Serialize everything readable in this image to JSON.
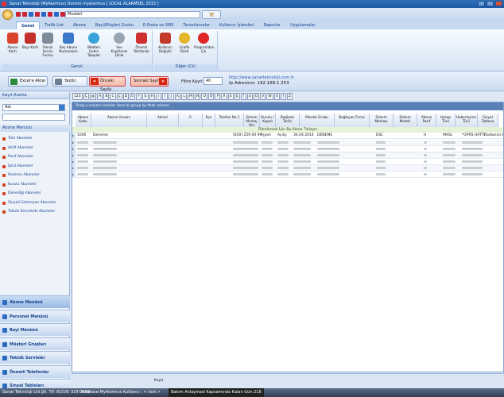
{
  "title": "Sanat Teknoloji (MyAlarmus) Donem myalarmus [ LOCAL ALARMSEL 2013 ]",
  "quick_combo": "Musteri",
  "tabs": [
    "Genel",
    "Trafik List",
    "Abone",
    "Bayi/Müşteri Grubu",
    "E-Posta ve SMS",
    "Tanımlamalar",
    "Kullanıcı İşlemleri",
    "Raporlar",
    "Uygulamalar"
  ],
  "ribbon": {
    "group_genel": "Genel",
    "group_diger": "Diğer (Ck)",
    "buttons": [
      "Abone Kartı",
      "Bayi Kartı",
      "Teknik Servis Formu",
      "Boş Abone Numaraları",
      "Webten Gelen Talepler",
      "Ses Kayıtlarını Dinle",
      "Önemli Telefonlar",
      "Kullanıcı Değiştir",
      "Grafik Özeti",
      "Programdan Çık"
    ]
  },
  "toolbar": {
    "excel": "Excel'e Aktar",
    "print": "Yazdır",
    "prev": "Önceki Sayfa",
    "next": "Sonraki Sayfa",
    "filtre_label": "Filtre Kayıt :",
    "filtre_value": "40",
    "web": "http://www.sanatteknoloji.com.tr",
    "ip": "Ip Adresiniz: 192.168.1.253"
  },
  "letters": [
    "123",
    "Ç",
    "@",
    "A",
    "B",
    "C",
    "Ç",
    "D",
    "E",
    "F",
    "G",
    "H",
    "I",
    "İ",
    "J",
    "K",
    "L",
    "M",
    "N",
    "O",
    "Ö",
    "P",
    "R",
    "S",
    "Ş",
    "T",
    "U",
    "Ü",
    "V",
    "W",
    "X",
    "Y",
    "Z"
  ],
  "left": {
    "kayit_arama": "Kayıt Arama",
    "combo_value": "Adı",
    "abone_menusu_header": "Abone Menüsü",
    "items": [
      "Tüm Aboneler",
      "Aktif Aboneler",
      "Pasif Aboneler",
      "İptal Aboneler",
      "Rezerve Aboneler",
      "Kurulu Aboneler",
      "Denediği Aboneler",
      "Sinyali Gelmeyen Aboneler",
      "Teknik Servisteki Aboneler"
    ],
    "big": [
      "Abone Menüsü",
      "Personel Menüsü",
      "Bayi Menüsü",
      "Müşteri Grupları",
      "Teknik Servisler",
      "Önemli Telefonlar",
      "Sinyal Tabloları"
    ]
  },
  "grid": {
    "group_hint": "Drag a column header here to group by that column",
    "filter_text": "Filtrelemek İçin Bu Alana Tıklayın",
    "columns": [
      "Abone Kodu",
      "Abone Unvanı",
      "Adresi",
      "İl",
      "İlçe",
      "Telefon No 1",
      "Sistem Montaj Yeri",
      "Kurulu / Kapalı",
      "Bağlantı Tarihi",
      "Meslek Grubu",
      "Bağlayan Firma",
      "Sistem Markası",
      "Sistem Modeli",
      "Abone Pasif",
      "Hesap Türü",
      "Haberleşme Türü",
      "Sinyal Tablosu"
    ],
    "first_row": {
      "kod": "1000",
      "unvan": "Deneme",
      "tel": "(850) 259 00 99",
      "montaj": "İşyeri",
      "kurulu": "Açılış",
      "tarih": "30.04.2014",
      "meslek": "DENEME",
      "marka": "DSC",
      "pasif": "H",
      "hesap": "MASL",
      "haber": "*GPRS HATTI",
      "sinyal": "Radionics Mo"
    }
  },
  "footer_label": "Kayıt",
  "status": {
    "left": "Sanat Teknoloji Ltd.Şti. Tlf: 0(216) 329 0099",
    "db": "Database:MyAlarmus Kullanıcı : < root >",
    "msg": "Bakım Anlaşmasi Kapsamında  Kalan Gün:218"
  }
}
